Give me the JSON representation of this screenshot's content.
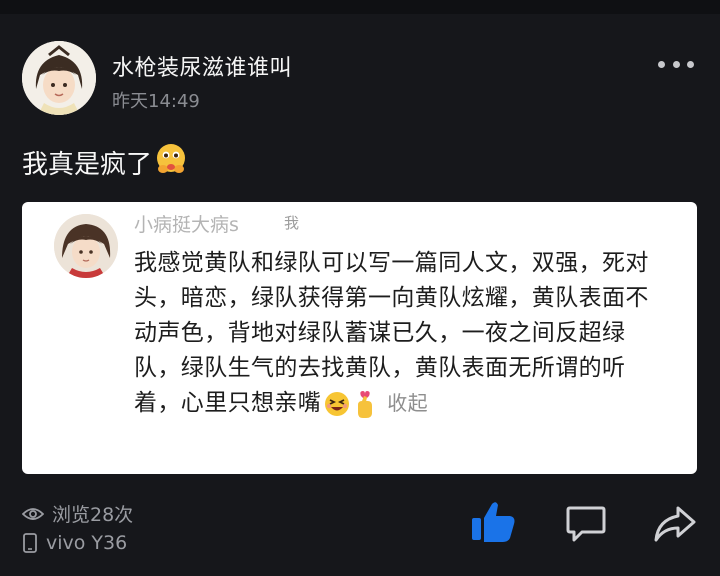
{
  "post": {
    "username": "水枪装尿滋谁谁叫",
    "timestamp": "昨天14:49",
    "text": "我真是疯了",
    "text_emoji": "pleading-hands-emoji",
    "menu_icon": "more-dots-icon"
  },
  "quoted_comment": {
    "username": "小病挺大病s",
    "self_tag": "我",
    "body": "我感觉黄队和绿队可以写一篇同人文，双强，死对头，暗恋，绿队获得第一向黄队炫耀，黄队表面不动声色，背地对绿队蓄谋已久，一夜之间反超绿队，绿队生气的去找黄队，黄队表面无所谓的听着，心里只想亲嘴",
    "collapse_label": "收起"
  },
  "footer": {
    "views": "浏览28次",
    "device": "vivo Y36",
    "like_icon": "thumbs-up-icon",
    "comment_icon": "comment-icon",
    "share_icon": "share-icon"
  },
  "colors": {
    "background": "#16171b",
    "card_background": "#ffffff",
    "like_active": "#1a73e8",
    "muted_text": "#9a9ca2"
  }
}
